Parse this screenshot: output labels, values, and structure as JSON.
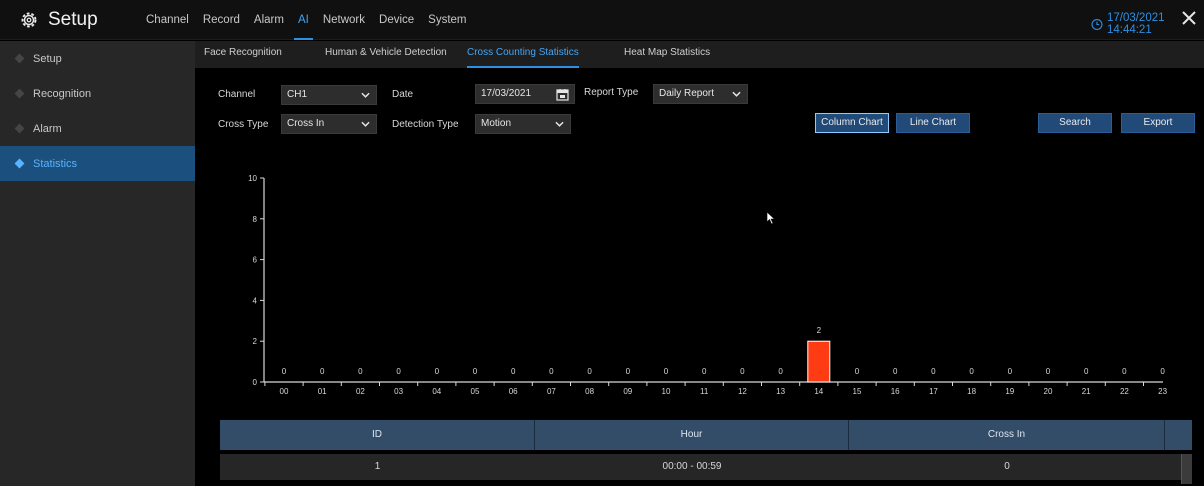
{
  "app": {
    "title": "Setup",
    "datetime": "17/03/2021 14:44:21"
  },
  "mainnav": [
    {
      "label": "Channel",
      "active": false
    },
    {
      "label": "Record",
      "active": false
    },
    {
      "label": "Alarm",
      "active": false
    },
    {
      "label": "AI",
      "active": true
    },
    {
      "label": "Network",
      "active": false
    },
    {
      "label": "Device",
      "active": false
    },
    {
      "label": "System",
      "active": false
    }
  ],
  "sidebar": {
    "items": [
      {
        "label": "Setup",
        "active": false
      },
      {
        "label": "Recognition",
        "active": false
      },
      {
        "label": "Alarm",
        "active": false
      },
      {
        "label": "Statistics",
        "active": true
      }
    ]
  },
  "subtabs": [
    {
      "label": "Face Recognition",
      "active": false
    },
    {
      "label": "Human & Vehicle Detection",
      "active": false
    },
    {
      "label": "Cross Counting Statistics",
      "active": true
    },
    {
      "label": "Heat Map Statistics",
      "active": false
    }
  ],
  "filters": {
    "channel_label": "Channel",
    "channel_value": "CH1",
    "date_label": "Date",
    "date_value": "17/03/2021",
    "report_type_label": "Report Type",
    "report_type_value": "Daily Report",
    "cross_type_label": "Cross Type",
    "cross_type_value": "Cross In",
    "detection_type_label": "Detection Type",
    "detection_type_value": "Motion"
  },
  "buttons": {
    "column_chart": "Column Chart",
    "line_chart": "Line Chart",
    "search": "Search",
    "export": "Export"
  },
  "colors": {
    "accent": "#2f8fe0",
    "bar": "#ff3b14",
    "table_header": "#334c68",
    "sidebar_active": "#1b4f7e"
  },
  "chart_data": {
    "type": "bar",
    "categories": [
      "00",
      "01",
      "02",
      "03",
      "04",
      "05",
      "06",
      "07",
      "08",
      "09",
      "10",
      "11",
      "12",
      "13",
      "14",
      "15",
      "16",
      "17",
      "18",
      "19",
      "20",
      "21",
      "22",
      "23"
    ],
    "values": [
      0,
      0,
      0,
      0,
      0,
      0,
      0,
      0,
      0,
      0,
      0,
      0,
      0,
      0,
      2,
      0,
      0,
      0,
      0,
      0,
      0,
      0,
      0,
      0
    ],
    "ylim": [
      0,
      10
    ],
    "yticks": [
      0,
      2,
      4,
      6,
      8,
      10
    ],
    "title": "",
    "xlabel": "",
    "ylabel": "",
    "grid": false
  },
  "table": {
    "columns": [
      "ID",
      "Hour",
      "Cross In"
    ],
    "rows": [
      [
        "1",
        "00:00 - 00:59",
        "0"
      ]
    ]
  }
}
